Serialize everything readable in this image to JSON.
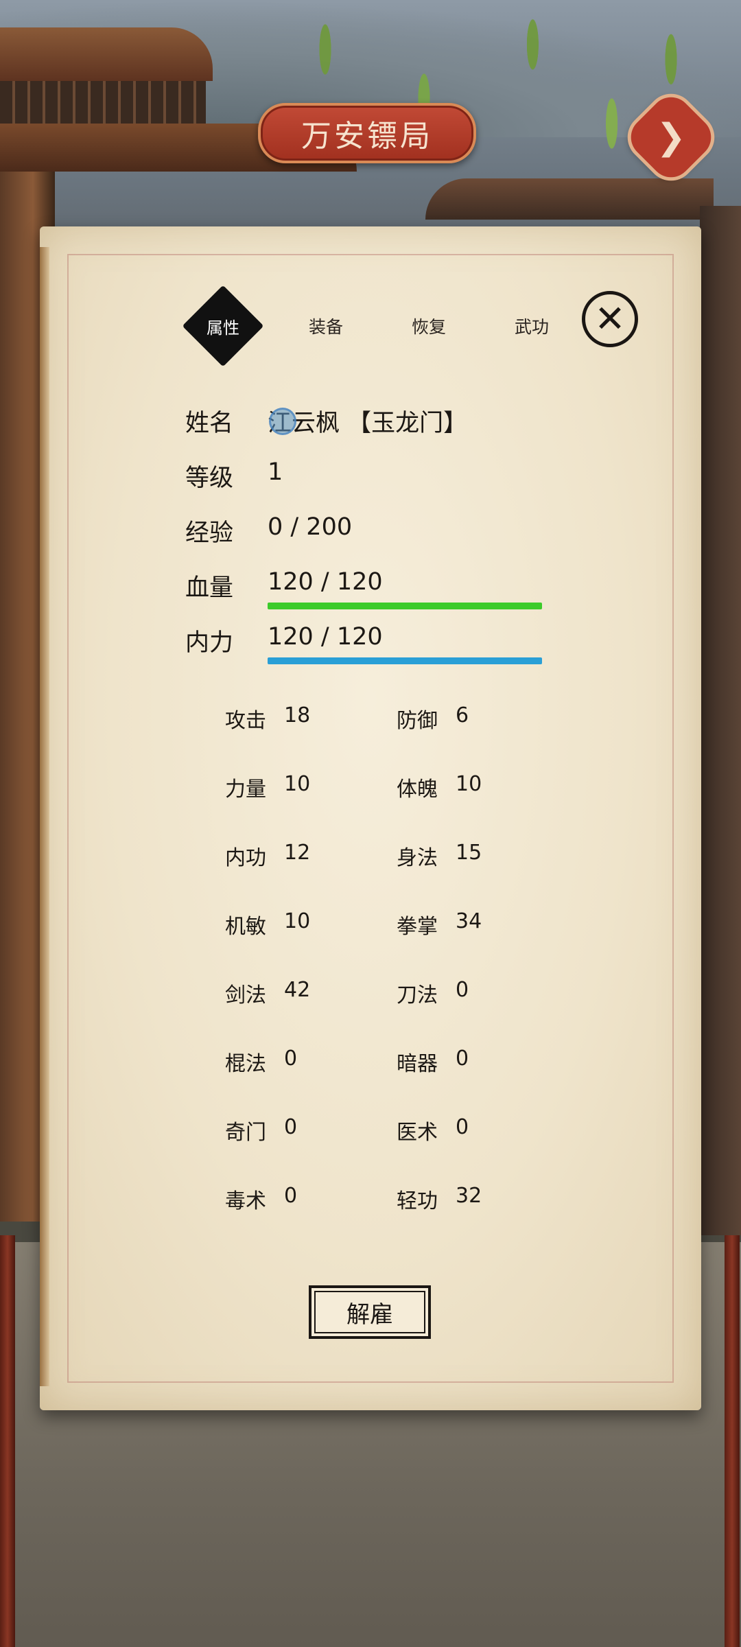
{
  "header": {
    "title": "万安镖局",
    "next_icon": "arrow-right-icon"
  },
  "tabs": [
    {
      "label": "属性",
      "active": true
    },
    {
      "label": "装备",
      "active": false
    },
    {
      "label": "恢复",
      "active": false
    },
    {
      "label": "武功",
      "active": false
    }
  ],
  "close_icon": "close-x-icon",
  "character": {
    "name_label": "姓名",
    "name_value": "江云枫 【玉龙门】",
    "level_label": "等级",
    "level_value": "1",
    "exp_label": "经验",
    "exp_value": "0 / 200",
    "hp_label": "血量",
    "hp_value": "120 / 120",
    "hp_fraction": 1.0,
    "hp_color": "#3ccb2a",
    "mp_label": "内力",
    "mp_value": "120 / 120",
    "mp_fraction": 1.0,
    "mp_color": "#2a9fd6"
  },
  "stats": [
    {
      "label": "攻击",
      "value": "18"
    },
    {
      "label": "防御",
      "value": "6"
    },
    {
      "label": "力量",
      "value": "10"
    },
    {
      "label": "体魄",
      "value": "10"
    },
    {
      "label": "内功",
      "value": "12"
    },
    {
      "label": "身法",
      "value": "15"
    },
    {
      "label": "机敏",
      "value": "10"
    },
    {
      "label": "拳掌",
      "value": "34"
    },
    {
      "label": "剑法",
      "value": "42"
    },
    {
      "label": "刀法",
      "value": "0"
    },
    {
      "label": "棍法",
      "value": "0"
    },
    {
      "label": "暗器",
      "value": "0"
    },
    {
      "label": "奇门",
      "value": "0"
    },
    {
      "label": "医术",
      "value": "0"
    },
    {
      "label": "毒术",
      "value": "0"
    },
    {
      "label": "轻功",
      "value": "32"
    }
  ],
  "dismiss_label": "解雇"
}
